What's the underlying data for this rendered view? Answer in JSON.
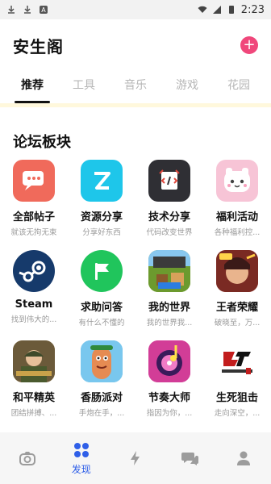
{
  "status_bar": {
    "time": "2:23"
  },
  "header": {
    "title": "安生阁",
    "add_label": "+"
  },
  "tabs": [
    {
      "label": "推荐"
    },
    {
      "label": "工具"
    },
    {
      "label": "音乐"
    },
    {
      "label": "游戏"
    },
    {
      "label": "花园"
    }
  ],
  "section": {
    "title": "论坛板块"
  },
  "forums": [
    {
      "title": "全部帖子",
      "sub": "就该无拘无束",
      "icon": "chat-bubble-icon",
      "color": "#f06a5b"
    },
    {
      "title": "资源分享",
      "sub": "分享好东西",
      "icon": "z-logo-icon",
      "color": "#1ec6ea"
    },
    {
      "title": "技术分享",
      "sub": "代码改变世界",
      "icon": "code-notebook-icon",
      "color": "#2f2f34"
    },
    {
      "title": "福利活动",
      "sub": "各种福利控...",
      "icon": "cute-face-icon",
      "color": "#f7c4d6"
    },
    {
      "title": "Steam",
      "sub": "找到伟大的...",
      "icon": "steam-icon",
      "color": "#163a6b"
    },
    {
      "title": "求助问答",
      "sub": "有什么不懂的",
      "icon": "flag-icon",
      "color": "#20c55c"
    },
    {
      "title": "我的世界",
      "sub": "我的世界我...",
      "icon": "minecraft-icon",
      "color": "#7aa33a"
    },
    {
      "title": "王者荣耀",
      "sub": "破晓至，万...",
      "icon": "hero-game-icon",
      "color": "#c4412a"
    },
    {
      "title": "和平精英",
      "sub": "团结拼搏、...",
      "icon": "soldier-icon",
      "color": "#b08a3b"
    },
    {
      "title": "香肠派对",
      "sub": "手炮在手，...",
      "icon": "sausage-icon",
      "color": "#5ab7e6"
    },
    {
      "title": "节奏大师",
      "sub": "指因为你，...",
      "icon": "music-disc-icon",
      "color": "#e34ba6"
    },
    {
      "title": "生死狙击",
      "sub": "走向深空，...",
      "icon": "sniper-logo-icon",
      "color": "#ffffff"
    }
  ],
  "bottom_nav": [
    {
      "label": "",
      "icon": "camera-icon"
    },
    {
      "label": "发现",
      "icon": "grid-icon"
    },
    {
      "label": "",
      "icon": "lightning-icon"
    },
    {
      "label": "",
      "icon": "chat-icon"
    },
    {
      "label": "",
      "icon": "user-icon"
    }
  ]
}
